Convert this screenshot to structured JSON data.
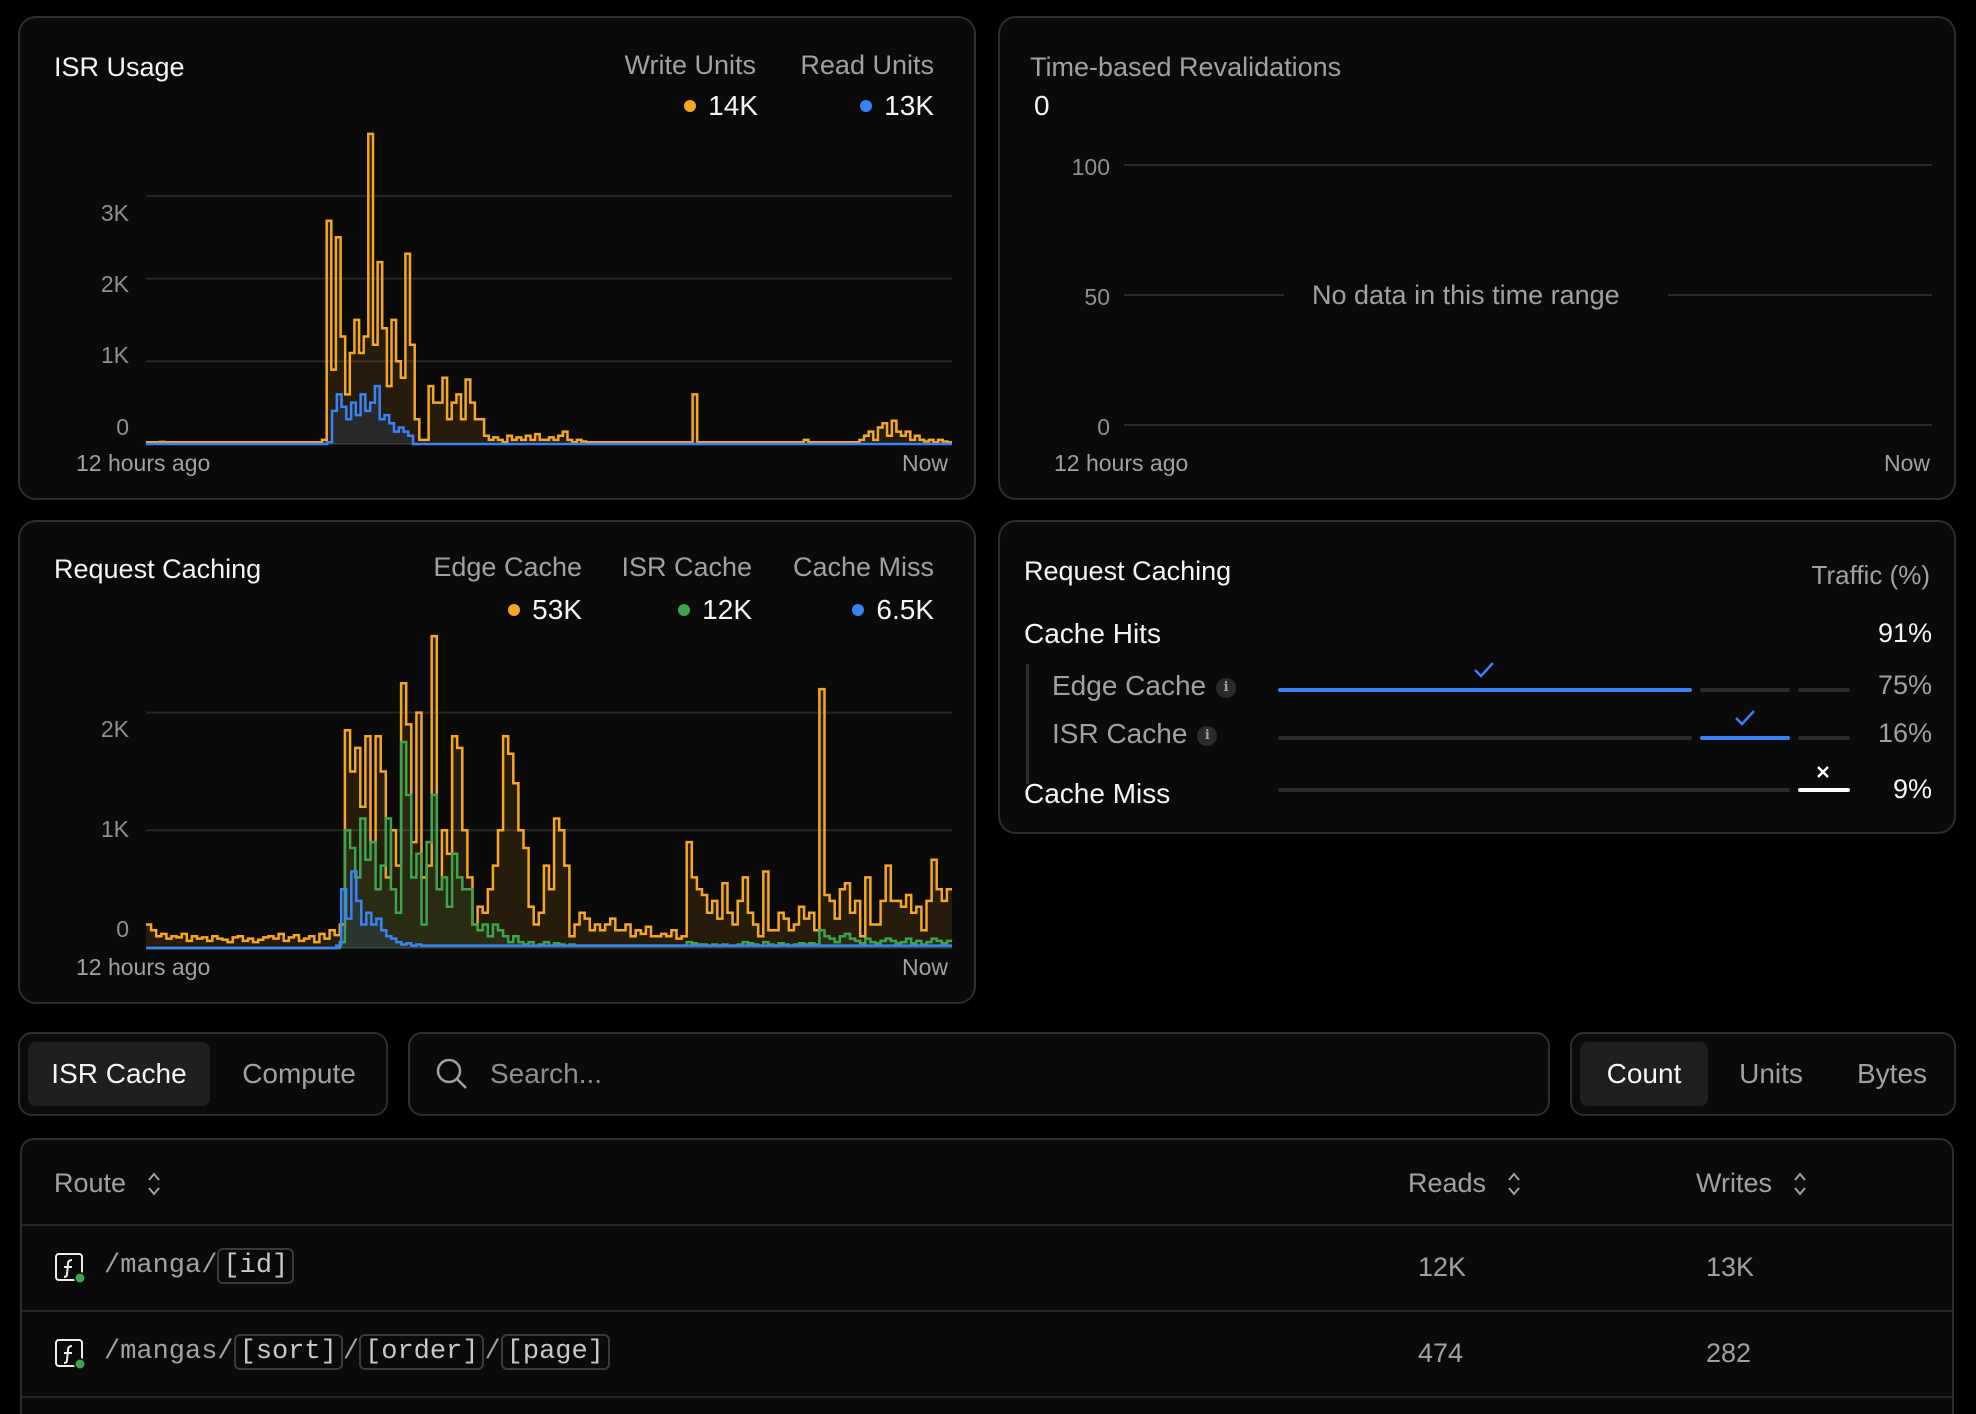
{
  "isr_usage": {
    "title": "ISR Usage",
    "legend": [
      {
        "label": "Write Units",
        "value": "14K",
        "color": "#f5a623"
      },
      {
        "label": "Read Units",
        "value": "13K",
        "color": "#3b82f6"
      }
    ],
    "x_start": "12 hours ago",
    "x_end": "Now"
  },
  "revalidations": {
    "title": "Time-based Revalidations",
    "value": "0",
    "empty_text": "No data in this time range",
    "x_start": "12 hours ago",
    "x_end": "Now"
  },
  "request_caching_chart": {
    "title": "Request Caching",
    "legend": [
      {
        "label": "Edge Cache",
        "value": "53K",
        "color": "#f5a623"
      },
      {
        "label": "ISR Cache",
        "value": "12K",
        "color": "#3fa34d"
      },
      {
        "label": "Cache Miss",
        "value": "6.5K",
        "color": "#3b82f6"
      }
    ],
    "x_start": "12 hours ago",
    "x_end": "Now"
  },
  "request_caching_breakdown": {
    "title": "Request Caching",
    "column_label": "Traffic (%)",
    "rows": [
      {
        "label": "Cache Hits",
        "pct": "91%",
        "share": 0.91
      },
      {
        "label": "Edge Cache",
        "pct": "75%",
        "share": 0.75
      },
      {
        "label": "ISR Cache",
        "pct": "16%",
        "share": 0.16
      },
      {
        "label": "Cache Miss",
        "pct": "9%",
        "share": 0.09
      }
    ],
    "colors": {
      "edge": "#3b82f6",
      "isr": "#3b82f6",
      "miss": "#ffffff",
      "track": "#2a2a2a"
    }
  },
  "source_tabs": {
    "active": "ISR Cache",
    "inactive": "Compute"
  },
  "search": {
    "placeholder": "Search..."
  },
  "metric_tabs": {
    "active": "Count",
    "units": "Units",
    "bytes": "Bytes"
  },
  "table": {
    "headers": {
      "route": "Route",
      "reads": "Reads",
      "writes": "Writes"
    },
    "rows": [
      {
        "route_parts": [
          "/manga/",
          "[id]"
        ],
        "reads": "12K",
        "writes": "13K"
      },
      {
        "route_parts": [
          "/mangas/",
          "[sort]",
          "/",
          "[order]",
          "/",
          "[page]"
        ],
        "reads": "474",
        "writes": "282"
      }
    ]
  },
  "chart_data": [
    {
      "type": "area",
      "title": "ISR Usage",
      "xlabel": "",
      "ylabel": "",
      "x_range": [
        "12 hours ago",
        "Now"
      ],
      "ylim": [
        0,
        3700
      ],
      "y_ticks": [
        "0",
        "1K",
        "2K",
        "3K"
      ],
      "grid": true,
      "series": [
        {
          "name": "Write Units",
          "color": "#f5a623",
          "values": [
            20,
            20,
            20,
            25,
            20,
            20,
            20,
            20,
            20,
            20,
            20,
            20,
            20,
            20,
            20,
            20,
            20,
            20,
            20,
            20,
            20,
            20,
            20,
            20,
            20,
            20,
            20,
            20,
            20,
            20,
            20,
            20,
            20,
            20,
            20,
            20,
            20,
            20,
            50,
            2700,
            900,
            2500,
            1300,
            600,
            1100,
            1500,
            1100,
            1300,
            3750,
            1200,
            2200,
            1400,
            700,
            1500,
            1000,
            800,
            2300,
            1200,
            300,
            50,
            50,
            700,
            500,
            500,
            800,
            300,
            500,
            600,
            300,
            780,
            500,
            300,
            300,
            100,
            50,
            80,
            50,
            20,
            100,
            50,
            80,
            50,
            100,
            50,
            120,
            50,
            50,
            80,
            50,
            100,
            150,
            50,
            20,
            50,
            30,
            20,
            20,
            20,
            20,
            20,
            20,
            20,
            20,
            20,
            20,
            20,
            20,
            20,
            20,
            20,
            20,
            20,
            20,
            20,
            20,
            20,
            20,
            20,
            600,
            20,
            20,
            20,
            20,
            20,
            20,
            20,
            20,
            20,
            20,
            20,
            20,
            20,
            20,
            20,
            20,
            20,
            20,
            20,
            20,
            20,
            20,
            20,
            50,
            20,
            20,
            20,
            20,
            20,
            20,
            20,
            20,
            20,
            20,
            20,
            50,
            100,
            150,
            50,
            200,
            250,
            100,
            280,
            150,
            100,
            150,
            50,
            100,
            50,
            30,
            50,
            20,
            50,
            30,
            20
          ]
        },
        {
          "name": "Read Units",
          "color": "#3b82f6",
          "values": [
            0,
            0,
            0,
            0,
            0,
            0,
            0,
            0,
            0,
            0,
            0,
            0,
            0,
            0,
            0,
            0,
            0,
            0,
            0,
            0,
            0,
            0,
            0,
            0,
            0,
            0,
            0,
            0,
            0,
            0,
            0,
            0,
            0,
            0,
            0,
            0,
            0,
            0,
            20,
            400,
            600,
            450,
            300,
            500,
            350,
            600,
            400,
            500,
            700,
            300,
            350,
            250,
            150,
            200,
            150,
            100,
            0,
            0,
            0,
            0,
            0,
            0,
            0,
            0,
            0,
            0,
            0,
            0,
            0,
            0,
            0,
            0,
            0,
            0,
            0,
            0,
            0,
            0,
            0,
            0,
            0,
            0,
            0,
            0,
            0,
            0,
            0,
            0,
            0,
            0,
            0,
            0,
            0,
            0,
            0,
            0,
            0,
            0,
            0,
            0,
            0,
            0,
            0,
            0,
            0,
            0,
            0,
            0,
            0,
            0,
            0,
            0,
            0,
            0,
            0,
            0,
            0,
            0,
            0,
            0,
            0,
            0,
            0,
            0,
            0,
            0,
            0,
            0,
            0,
            0,
            0,
            0,
            0,
            0,
            0,
            0,
            0,
            0,
            0,
            0,
            0,
            0,
            0,
            0,
            0,
            0,
            0,
            0,
            0,
            0,
            0,
            0,
            0,
            0,
            0,
            0,
            0,
            0,
            0,
            0,
            0,
            0,
            0,
            0,
            0,
            0,
            0,
            0,
            0
          ]
        }
      ]
    },
    {
      "type": "line",
      "title": "Time-based Revalidations",
      "x_range": [
        "12 hours ago",
        "Now"
      ],
      "ylim": [
        0,
        100
      ],
      "y_ticks": [
        "0",
        "50",
        "100"
      ],
      "grid": true,
      "series": []
    },
    {
      "type": "area",
      "title": "Request Caching",
      "x_range": [
        "12 hours ago",
        "Now"
      ],
      "ylim": [
        0,
        2600
      ],
      "y_ticks": [
        "0",
        "1K",
        "2K"
      ],
      "grid": true,
      "series": [
        {
          "name": "Edge Cache",
          "color": "#f5a623",
          "values": [
            200,
            150,
            100,
            120,
            80,
            100,
            90,
            120,
            60,
            100,
            80,
            90,
            60,
            100,
            80,
            70,
            50,
            90,
            100,
            60,
            80,
            50,
            70,
            90,
            100,
            80,
            120,
            60,
            90,
            110,
            60,
            80,
            100,
            50,
            120,
            80,
            150,
            110,
            200,
            1850,
            1500,
            1700,
            1200,
            1800,
            900,
            1800,
            1500,
            600,
            1000,
            700,
            2250,
            1900,
            900,
            2000,
            600,
            700,
            2650,
            500,
            1000,
            800,
            1800,
            1700,
            1000,
            600,
            200,
            350,
            300,
            500,
            700,
            1000,
            1800,
            1650,
            1400,
            1000,
            850,
            350,
            200,
            300,
            700,
            500,
            1100,
            1000,
            700,
            100,
            200,
            300,
            250,
            150,
            200,
            150,
            200,
            250,
            150,
            150,
            200,
            100,
            150,
            120,
            180,
            100,
            100,
            120,
            100,
            150,
            80,
            100,
            900,
            600,
            500,
            450,
            300,
            400,
            250,
            550,
            300,
            200,
            400,
            600,
            300,
            200,
            100,
            650,
            150,
            150,
            300,
            250,
            150,
            200,
            350,
            250,
            300,
            150,
            2200,
            450,
            400,
            250,
            500,
            550,
            300,
            400,
            100,
            600,
            200,
            200,
            400,
            700,
            400,
            400,
            350,
            450,
            300,
            350,
            150,
            400,
            750,
            500,
            400,
            500
          ]
        },
        {
          "name": "ISR Cache",
          "color": "#3fa34d",
          "values": [
            0,
            0,
            0,
            0,
            0,
            0,
            0,
            0,
            0,
            0,
            0,
            0,
            0,
            0,
            0,
            0,
            0,
            0,
            0,
            0,
            0,
            0,
            0,
            0,
            0,
            0,
            0,
            0,
            0,
            0,
            0,
            0,
            0,
            0,
            0,
            0,
            0,
            0,
            50,
            1000,
            850,
            600,
            1100,
            750,
            900,
            500,
            700,
            1100,
            500,
            300,
            1750,
            1300,
            600,
            800,
            200,
            900,
            1300,
            500,
            600,
            350,
            800,
            600,
            500,
            500,
            200,
            150,
            200,
            100,
            200,
            150,
            100,
            50,
            100,
            50,
            30,
            50,
            20,
            30,
            50,
            20,
            40,
            30,
            20,
            30,
            20,
            20,
            20,
            20,
            20,
            20,
            20,
            20,
            20,
            20,
            20,
            20,
            20,
            20,
            20,
            20,
            20,
            20,
            20,
            20,
            20,
            20,
            50,
            40,
            30,
            30,
            20,
            30,
            20,
            30,
            20,
            20,
            30,
            50,
            40,
            30,
            20,
            50,
            30,
            20,
            40,
            30,
            20,
            30,
            40,
            30,
            40,
            30,
            150,
            100,
            80,
            50,
            100,
            120,
            80,
            60,
            40,
            80,
            50,
            40,
            60,
            80,
            60,
            40,
            50,
            80,
            40,
            60,
            30,
            50,
            80,
            60,
            40,
            60
          ]
        },
        {
          "name": "Cache Miss",
          "color": "#3b82f6",
          "values": [
            0,
            0,
            0,
            0,
            0,
            0,
            0,
            0,
            0,
            0,
            0,
            0,
            0,
            0,
            0,
            0,
            0,
            0,
            0,
            0,
            0,
            0,
            0,
            0,
            0,
            0,
            0,
            0,
            0,
            0,
            0,
            0,
            0,
            0,
            0,
            0,
            0,
            0,
            20,
            500,
            250,
            650,
            400,
            200,
            300,
            200,
            250,
            150,
            100,
            80,
            50,
            30,
            40,
            20,
            30,
            20,
            20,
            20,
            20,
            20,
            20,
            20,
            20,
            20,
            20,
            20,
            20,
            20,
            20,
            20,
            20,
            20,
            20,
            20,
            20,
            20,
            20,
            20,
            20,
            20,
            20,
            20,
            20,
            20,
            20,
            20,
            20,
            20,
            20,
            20,
            20,
            20,
            20,
            20,
            20,
            20,
            20,
            20,
            20,
            20,
            20,
            20,
            20,
            20,
            20,
            20,
            20,
            20,
            20,
            20,
            20,
            20,
            20,
            20,
            20,
            20,
            20,
            20,
            20,
            20,
            20,
            20,
            20,
            20,
            20,
            20,
            20,
            20,
            20,
            20,
            20,
            20,
            20,
            20,
            20,
            20,
            20,
            20,
            20,
            20,
            20,
            20,
            20,
            20,
            20,
            20,
            20,
            20,
            20,
            20,
            20,
            20,
            20,
            20,
            20,
            20,
            20,
            20,
            20,
            20,
            20
          ]
        }
      ]
    }
  ]
}
